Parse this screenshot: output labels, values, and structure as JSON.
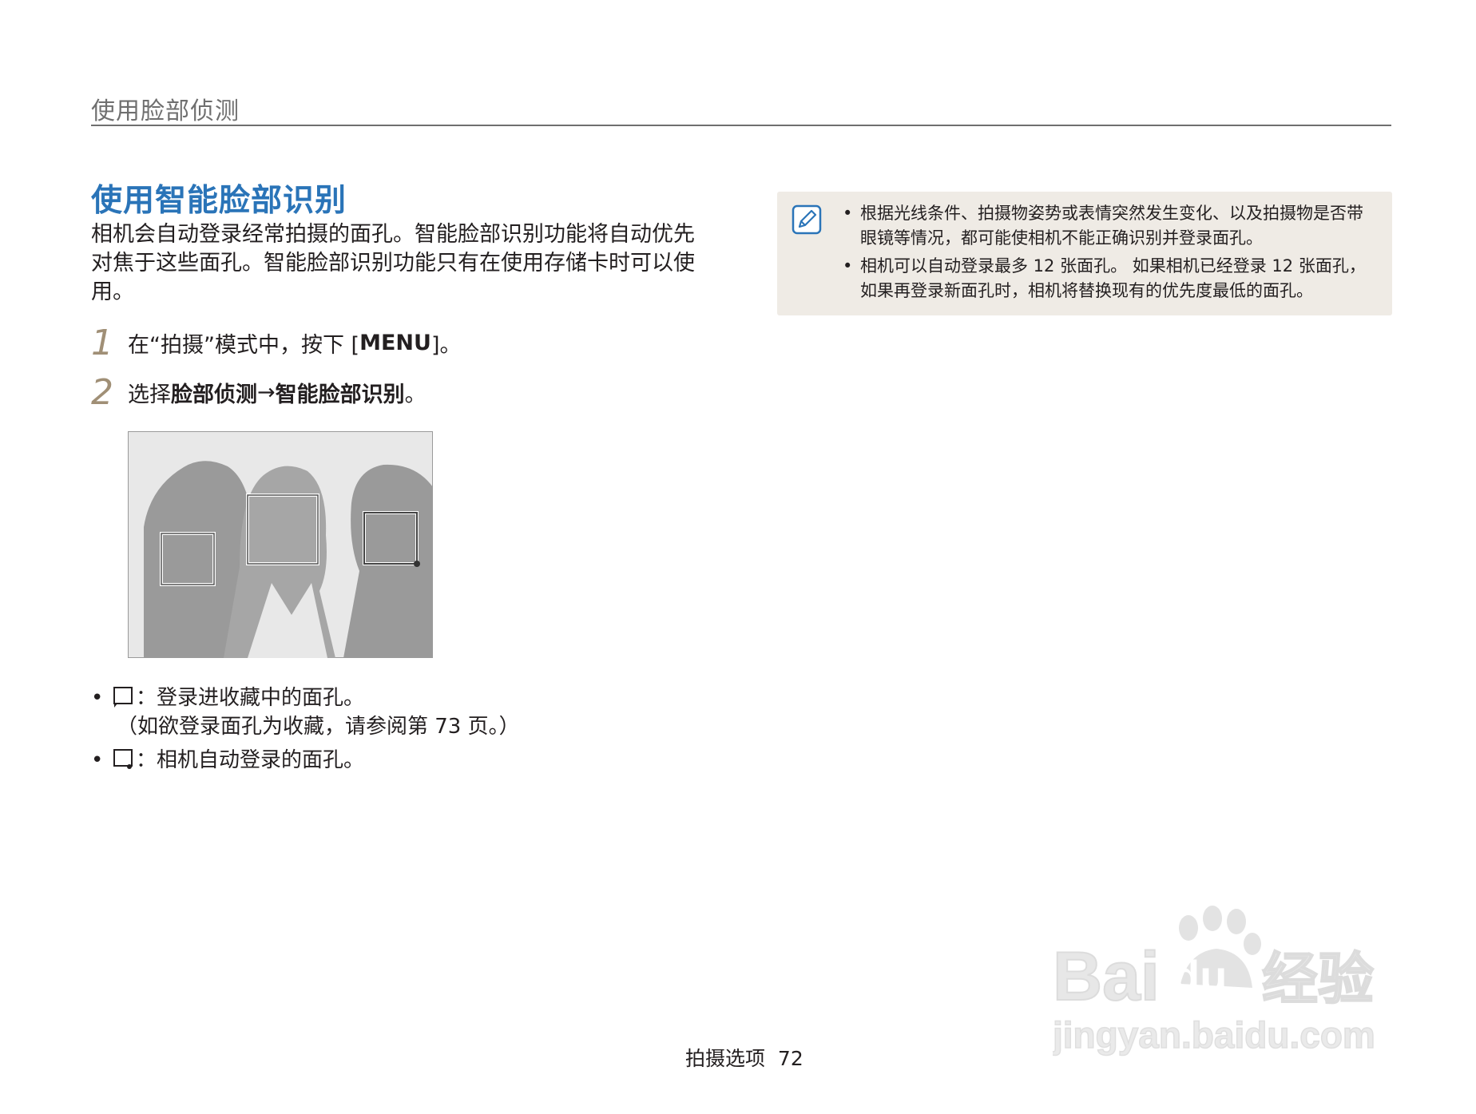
{
  "header": {
    "section_title": "使用脸部侦测"
  },
  "main": {
    "title": "使用智能脸部识别",
    "intro": "相机会自动登录经常拍摄的面孔。智能脸部识别功能将自动优先对焦于这些面孔。智能脸部识别功能只有在使用存储卡时可以使用。",
    "steps": [
      {
        "num": "1",
        "text_prefix": "在“拍摄”模式中，按下 [",
        "key": "MENU",
        "text_suffix": "]。"
      },
      {
        "num": "2",
        "text_prefix": "选择",
        "bold1": "脸部侦测",
        "arrow": " → ",
        "bold2": "智能脸部识别",
        "text_suffix": "。"
      }
    ],
    "bullets": [
      {
        "dot": "•",
        "text": "：登录进收藏中的面孔。",
        "sub": "（如欲登录面孔为收藏，请参阅第 73 页。）",
        "icon": "favorite-face-frame-icon"
      },
      {
        "dot": "•",
        "text": "：相机自动登录的面孔。",
        "icon": "auto-face-frame-icon"
      }
    ]
  },
  "note": {
    "icon": "note-pencil-icon",
    "items": [
      "根据光线条件、拍摄物姿势或表情突然发生变化、以及拍摄物是否带眼镜等情况，都可能使相机不能正确识别并登录面孔。",
      "相机可以自动登录最多 12 张面孔。 如果相机已经登录 12 张面孔，如果再登录新面孔时，相机将替换现有的优先度最低的面孔。"
    ]
  },
  "footer": {
    "section": "拍摄选项",
    "page": "72"
  },
  "watermark": {
    "brand": "Bai",
    "brand2": "du",
    "cn": "经验",
    "url": "jingyan.baidu.com"
  },
  "colors": {
    "title": "#2a74b8",
    "note_bg": "#efebe5",
    "step_num": "#a08f76",
    "illustration_bg": "#e8e8e8",
    "silhouette": "#9a9a9a"
  }
}
